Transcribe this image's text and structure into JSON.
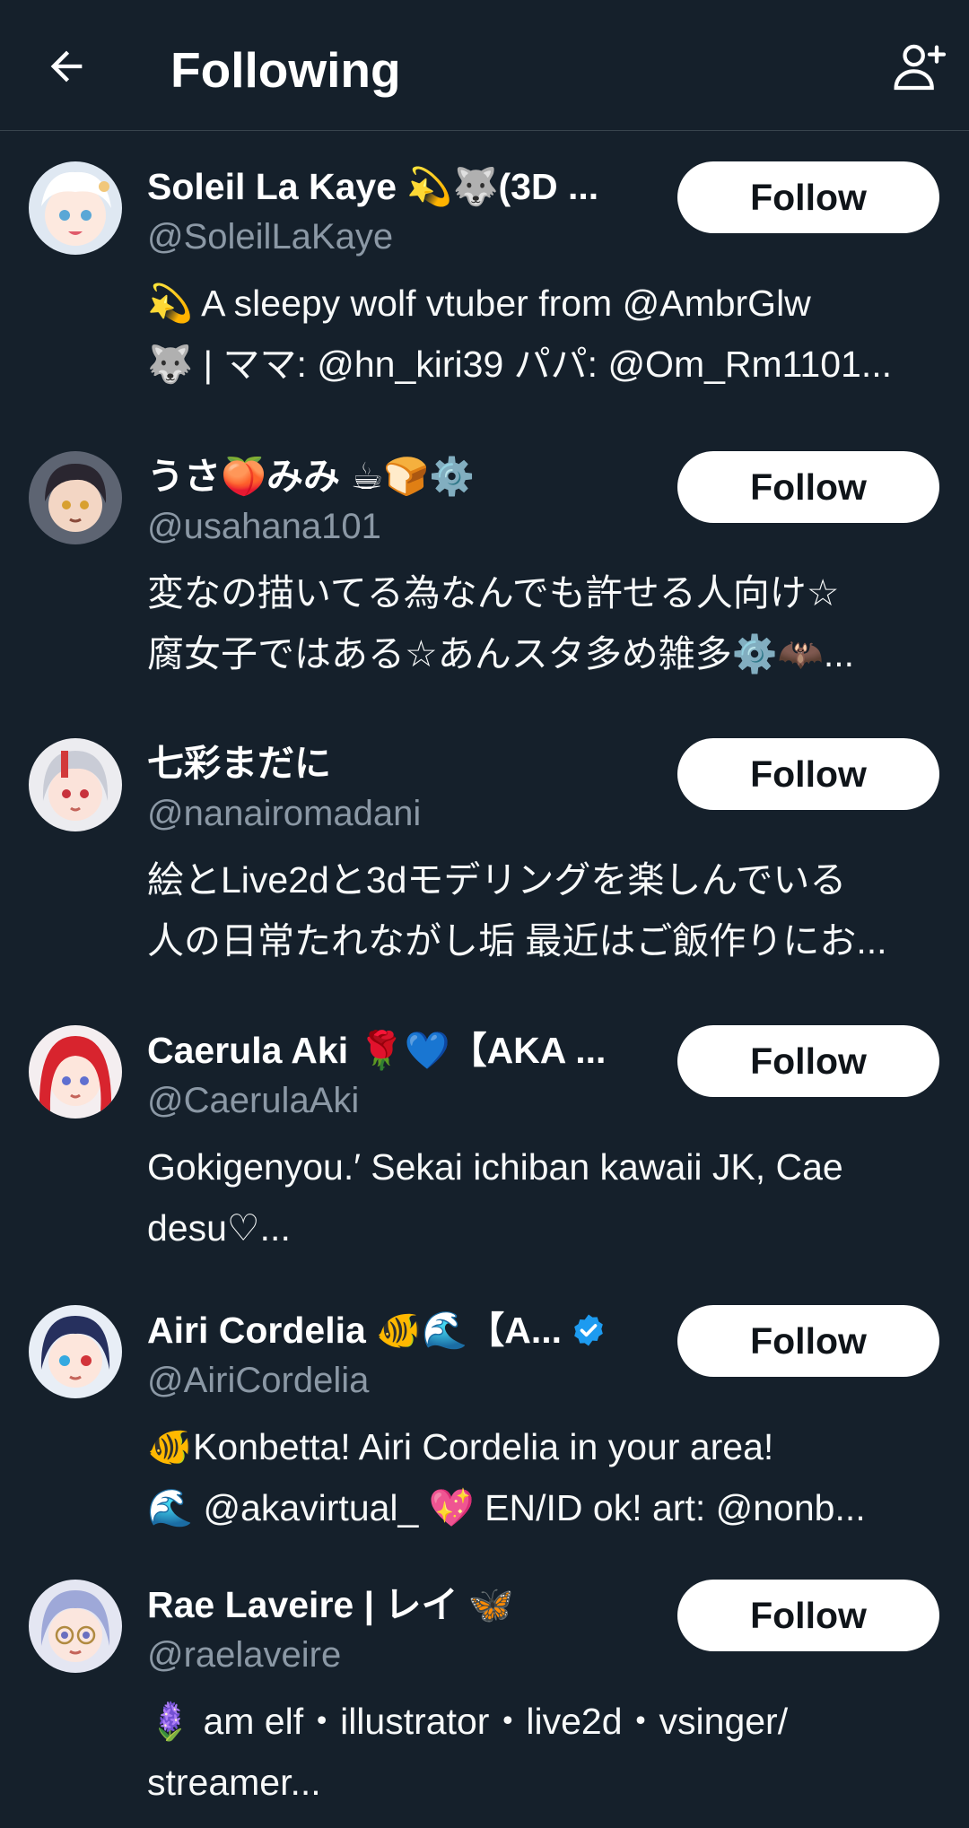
{
  "header": {
    "title": "Following",
    "back_icon": "arrow-left-icon",
    "add_icon": "add-user-icon"
  },
  "colors": {
    "background": "#15202b",
    "divider": "#38444d",
    "secondary_text": "#8b98a5",
    "button_bg": "#ffffff",
    "button_text": "#0f1419",
    "verified": "#1d9bf0"
  },
  "users": [
    {
      "name": "Soleil La Kaye 💫🐺(3D ...",
      "handle": "@SoleilLaKaye",
      "bio": [
        "💫 A sleepy wolf vtuber from @AmbrGlw",
        "🐺 |  ママ: @hn_kiri39 パパ: @Om_Rm1101..."
      ],
      "follow_label": "Follow",
      "verified": false
    },
    {
      "name": "うさ🍑みみ ☕🍞⚙️",
      "handle": "@usahana101",
      "bio": [
        "変なの描いてる為なんでも許せる人向け☆",
        "腐女子ではある☆あんスタ多め雑多⚙️🦇..."
      ],
      "follow_label": "Follow",
      "verified": false
    },
    {
      "name": "七彩まだに",
      "handle": "@nanairomadani",
      "bio": [
        "絵とLive2dと3dモデリングを楽しんでいる",
        "人の日常たれながし垢 最近はご飯作りにお..."
      ],
      "follow_label": "Follow",
      "verified": false
    },
    {
      "name": "Caerula Aki 🌹💙【AKA ...",
      "handle": "@CaerulaAki",
      "bio": [
        "Gokigenyou.′ Sekai ichiban kawaii JK, Cae",
        "desu♡..."
      ],
      "follow_label": "Follow",
      "verified": false
    },
    {
      "name": "Airi Cordelia 🐠🌊【A...",
      "handle": "@AiriCordelia",
      "bio": [
        "🐠Konbetta! Airi Cordelia in your area!",
        "🌊 @akavirtual_ 💖 EN/ID ok! art: @nonb..."
      ],
      "follow_label": "Follow",
      "verified": true
    },
    {
      "name": "Rae Laveire | レイ 🦋",
      "handle": "@raelaveire",
      "bio": [
        "🪻 am elf・illustrator・live2d・vsinger/",
        "streamer..."
      ],
      "follow_label": "Follow",
      "verified": false
    }
  ]
}
